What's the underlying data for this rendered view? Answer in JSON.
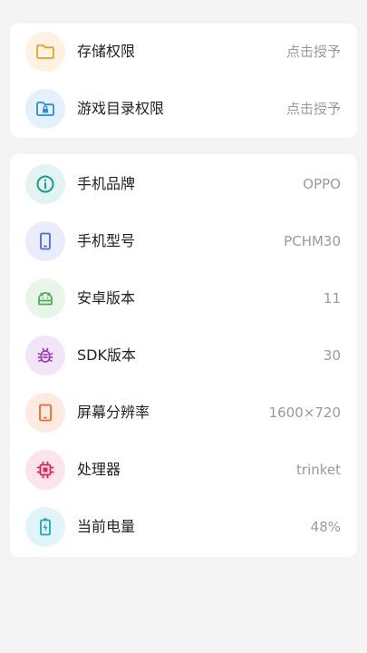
{
  "permissions": {
    "items": [
      {
        "label": "存储权限",
        "value": "点击授予",
        "icon": "folder-icon",
        "color": "#f0a020",
        "bg": "#fff2e2"
      },
      {
        "label": "游戏目录权限",
        "value": "点击授予",
        "icon": "folder-lock-icon",
        "color": "#2a8fd8",
        "bg": "#e3f1fc"
      }
    ]
  },
  "device": {
    "items": [
      {
        "label": "手机品牌",
        "value": "OPPO",
        "icon": "info-icon",
        "color": "#1a9a8a",
        "bg": "#e2f4f1"
      },
      {
        "label": "手机型号",
        "value": "PCHM30",
        "icon": "phone-icon",
        "color": "#4a6bd8",
        "bg": "#e8ecfb"
      },
      {
        "label": "安卓版本",
        "value": "11",
        "icon": "android-icon",
        "color": "#4caf50",
        "bg": "#e8f5e9"
      },
      {
        "label": "SDK版本",
        "value": "30",
        "icon": "bug-icon",
        "color": "#9c3cc0",
        "bg": "#f3e5f8"
      },
      {
        "label": "屏幕分辨率",
        "value": "1600×720",
        "icon": "tablet-icon",
        "color": "#f06a30",
        "bg": "#fdebe2"
      },
      {
        "label": "处理器",
        "value": "trinket",
        "icon": "chip-icon",
        "color": "#e0245a",
        "bg": "#fce4ea"
      },
      {
        "label": "当前电量",
        "value": "48%",
        "icon": "battery-charging-icon",
        "color": "#18a8c0",
        "bg": "#e0f5f9"
      }
    ]
  }
}
